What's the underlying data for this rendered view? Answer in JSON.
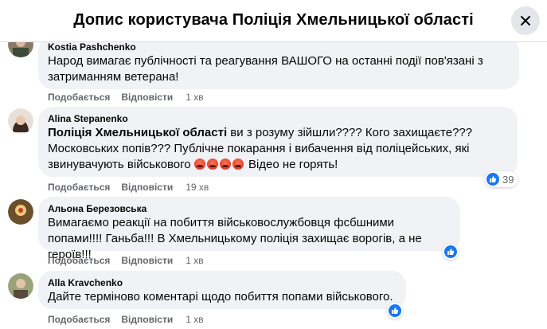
{
  "header": {
    "title": "Допис користувача Поліція Хмельницької області"
  },
  "actions": {
    "like": "Подобається",
    "reply": "Відповісти"
  },
  "comments": [
    {
      "author": "Kostia Pashchenko",
      "text": "Народ вимагає публічності та реагування ВАШОГО на останні події пов'язані з затриманням ветерана!",
      "time": "1 хв"
    },
    {
      "author": "Alina Stepanenko",
      "mention": "Поліція Хмельницької області",
      "text_a": " ви з розуму зійшли???? Кого захищаєте??? Московських попів??? Публічне покарання і вибачення від поліцейських, які звинувачують військового ",
      "text_b": " Відео не горять!",
      "time": "19 хв",
      "reactions": "39"
    },
    {
      "author": "Альона Березовська",
      "text": "Вимагаємо реакції на побиття військовослужбовця фсбшними попами!!!! Ганьба!!! В Хмельницькому поліція захищає ворогів, а не героїв!!!",
      "time": "1 хв"
    },
    {
      "author": "Alla Kravchenko",
      "text": "Дайте терміново коментарі щодо побиття попами військового.",
      "time": "1 хв"
    }
  ],
  "icons": {
    "close": "close-icon",
    "like": "thumbs-up-icon",
    "angry": "angry-face-emoji"
  },
  "colors": {
    "accent": "#1877f2",
    "bubble": "#f0f2f5",
    "meta": "#65676b"
  }
}
